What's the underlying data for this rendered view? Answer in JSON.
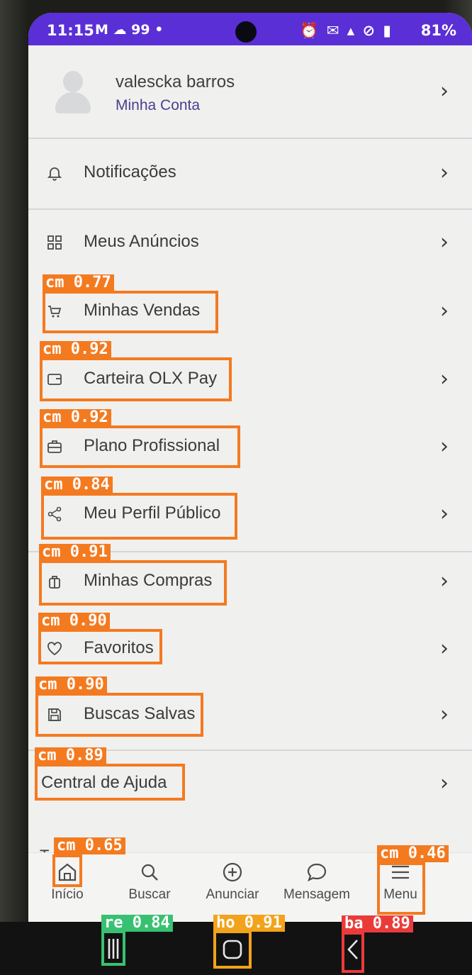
{
  "status_bar": {
    "time": "11:15",
    "left_icons": "M ☁ 99 •",
    "battery": "81%"
  },
  "profile": {
    "name": "valescka barros",
    "subtitle": "Minha Conta"
  },
  "menu": [
    {
      "label": "Notificações",
      "icon": "bell-icon"
    },
    {
      "label": "Meus Anúncios",
      "icon": "grid-icon"
    },
    {
      "label": "Minhas Vendas",
      "icon": "cart-icon"
    },
    {
      "label": "Carteira OLX Pay",
      "icon": "wallet-icon"
    },
    {
      "label": "Plano Profissional",
      "icon": "briefcase-icon"
    },
    {
      "label": "Meu Perfil Público",
      "icon": "share-icon"
    },
    {
      "label": "Minhas Compras",
      "icon": "shopping-bag-icon"
    },
    {
      "label": "Favoritos",
      "icon": "heart-icon"
    },
    {
      "label": "Buscas Salvas",
      "icon": "save-icon"
    },
    {
      "label": "Central de Ajuda",
      "icon": ""
    }
  ],
  "partial_text": "Te",
  "bottom_nav": [
    {
      "label": "Início",
      "icon": "home-icon"
    },
    {
      "label": "Buscar",
      "icon": "search-icon"
    },
    {
      "label": "Anunciar",
      "icon": "plus-circle-icon"
    },
    {
      "label": "Mensagem",
      "icon": "chat-icon"
    },
    {
      "label": "Menu",
      "icon": "menu-icon"
    }
  ],
  "system_nav": [
    "recents-icon",
    "home-button-icon",
    "back-icon"
  ],
  "detections": [
    {
      "tag": "cm 0.77"
    },
    {
      "tag": "cm 0.92"
    },
    {
      "tag": "cm 0.92"
    },
    {
      "tag": "cm 0.84"
    },
    {
      "tag": "cm 0.91"
    },
    {
      "tag": "cm 0.90"
    },
    {
      "tag": "cm 0.90"
    },
    {
      "tag": "cm 0.89"
    },
    {
      "tag": "cm 0.65"
    },
    {
      "tag": "cm 0.46"
    },
    {
      "tag": "re 0.84"
    },
    {
      "tag": "ho 0.91"
    },
    {
      "tag": "ba 0.89"
    }
  ],
  "colors": {
    "status_bar": "#5a2fd6",
    "detection_orange": "#f47a20",
    "detection_green": "#38c172",
    "detection_amber": "#f2a31b",
    "detection_red": "#ea3b3b"
  }
}
